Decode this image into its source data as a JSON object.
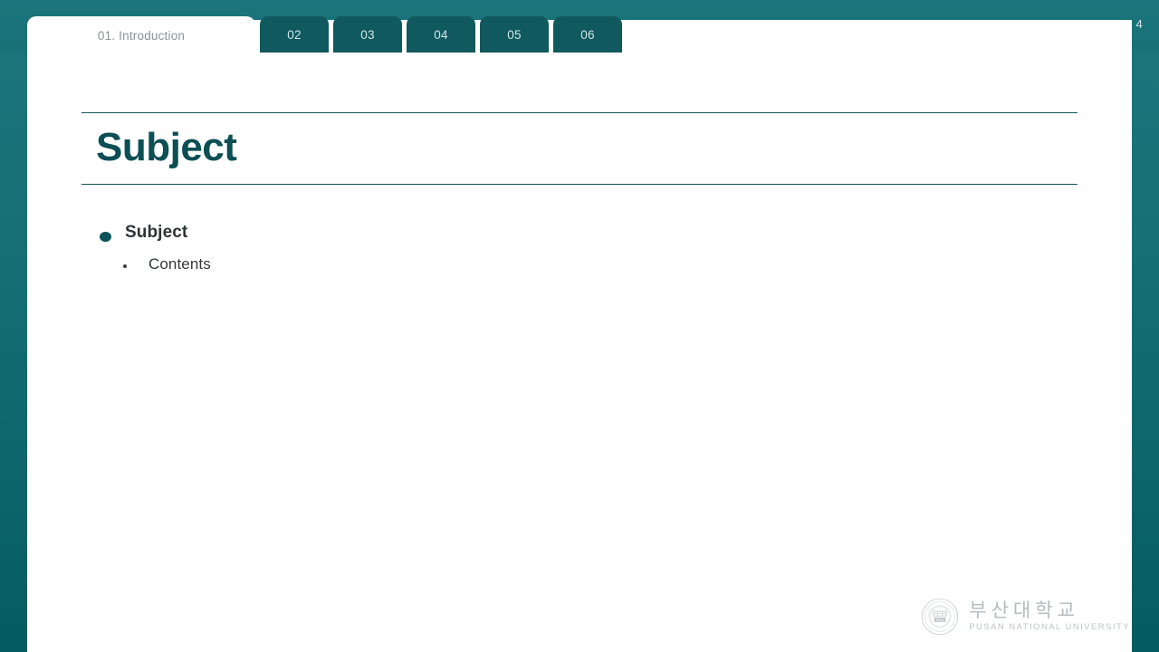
{
  "slide": {
    "page_number": "4",
    "title": "Subject",
    "accent_color": "#0c4f55",
    "background_color": "#177177",
    "card_color": "#ffffff"
  },
  "tabs": [
    {
      "label": "01. Introduction",
      "active": true
    },
    {
      "label": "02",
      "active": false
    },
    {
      "label": "03",
      "active": false
    },
    {
      "label": "04",
      "active": false
    },
    {
      "label": "05",
      "active": false
    },
    {
      "label": "06",
      "active": false
    }
  ],
  "body": {
    "level1": "Subject",
    "level2": "Contents"
  },
  "logo": {
    "name_kr": "부산대학교",
    "name_en": "PUSAN NATIONAL UNIVERSITY",
    "seal_text": "PNU"
  }
}
